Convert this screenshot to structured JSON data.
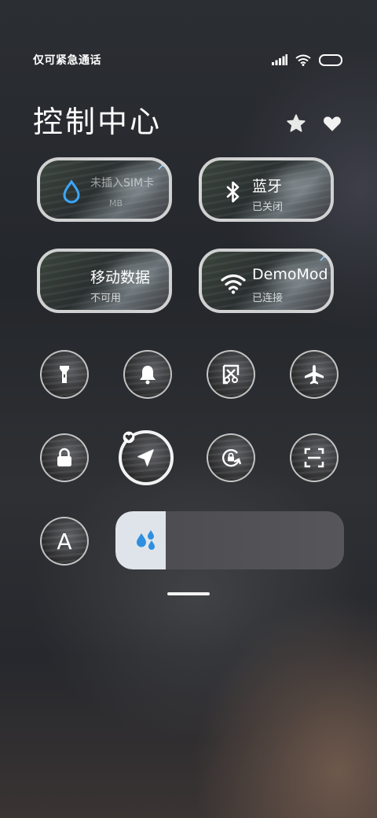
{
  "status_bar": {
    "carrier_text": "仅可紧急通话"
  },
  "header": {
    "title": "控制中心"
  },
  "tiles": [
    {
      "label": "未插入SIM卡",
      "sub": "MB"
    },
    {
      "label": "蓝牙",
      "sub": "已关闭"
    },
    {
      "label": "移动数据",
      "sub": "不可用"
    },
    {
      "label": "DemoMod",
      "sub": "已连接"
    }
  ],
  "toggles": {
    "row1": [
      "flashlight-icon",
      "bell-icon",
      "screenshot-icon",
      "airplane-icon"
    ],
    "row2": [
      "lock-icon",
      "location-icon",
      "rotation-lock-icon",
      "scan-icon"
    ],
    "font_button_text": "A"
  },
  "brightness": {
    "level": 0.22
  },
  "colors": {
    "accent_blue": "#3aa8ff",
    "tile_border": "#ebebeb"
  }
}
